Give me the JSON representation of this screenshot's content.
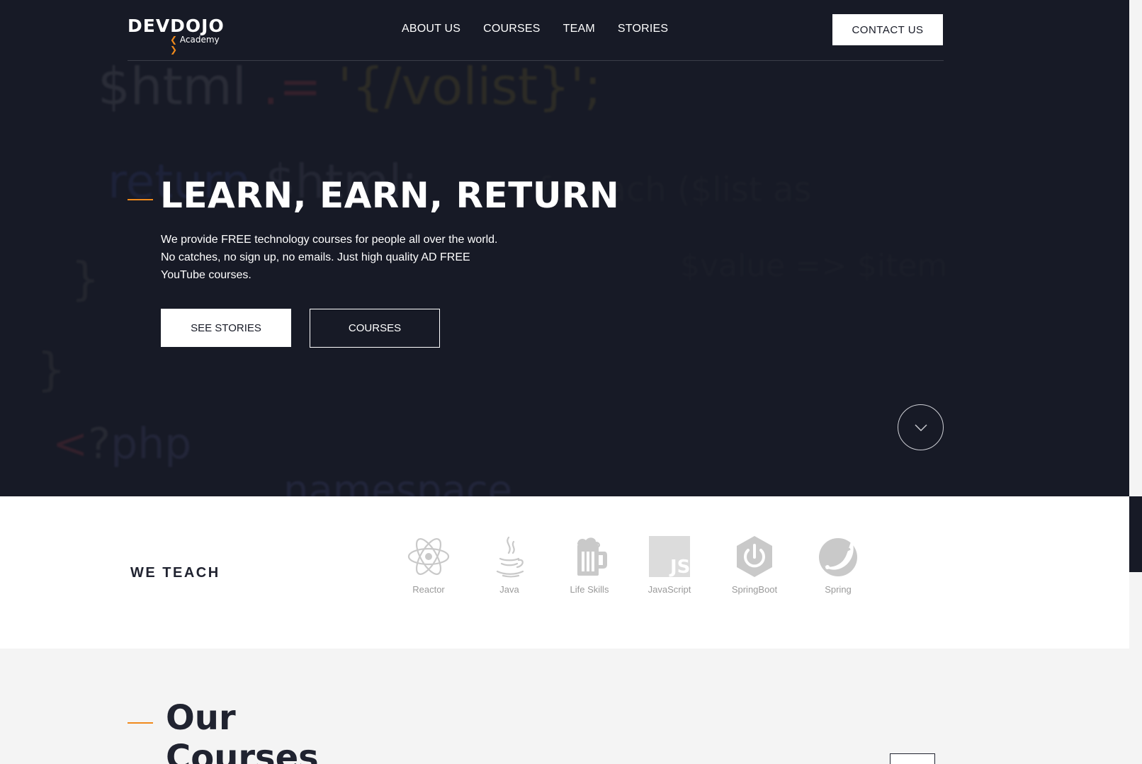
{
  "nav": {
    "logo_main": "DEVDOJO",
    "logo_sub": "Academy",
    "logo_bracket_left": "❮",
    "logo_bracket_right": "❯",
    "items": [
      {
        "label": "ABOUT US"
      },
      {
        "label": "COURSES"
      },
      {
        "label": "TEAM"
      },
      {
        "label": "STORIES"
      }
    ],
    "contact_label": "CONTACT US"
  },
  "background_code": {
    "line1_var": "$html",
    "line1_eq": ".=",
    "line1_str": "'{/volist}';",
    "line2_kw": "return",
    "line2_var": "$html;",
    "line3": "}",
    "line4": "}",
    "line5_lt": "<",
    "line5_q": "?",
    "line5_php": "php",
    "line6": "namespace",
    "line7": "foreach ($list as",
    "line8": "$value => $item"
  },
  "hero": {
    "title": "LEARN, EARN, RETURN",
    "description": "We provide FREE technology courses for people all over the world. No catches, no sign up, no emails. Just high quality AD FREE YouTube courses.",
    "see_stories_label": "SEE STORIES",
    "courses_label": "COURSES"
  },
  "teach": {
    "title": "WE TEACH",
    "items": [
      {
        "label": "Reactor",
        "icon": "reactor-atom-icon"
      },
      {
        "label": "Java",
        "icon": "java-cup-icon"
      },
      {
        "label": "Life Skills",
        "icon": "beer-mug-icon"
      },
      {
        "label": "JavaScript",
        "icon": "javascript-icon"
      },
      {
        "label": "SpringBoot",
        "icon": "power-icon"
      },
      {
        "label": "Spring",
        "icon": "spring-leaf-icon"
      }
    ]
  },
  "courses_section": {
    "title": "Our Courses"
  },
  "colors": {
    "hero_bg": "#171a26",
    "accent": "#f08a1c",
    "text_dark": "#202330",
    "icon_gray": "#c9c9c9"
  }
}
